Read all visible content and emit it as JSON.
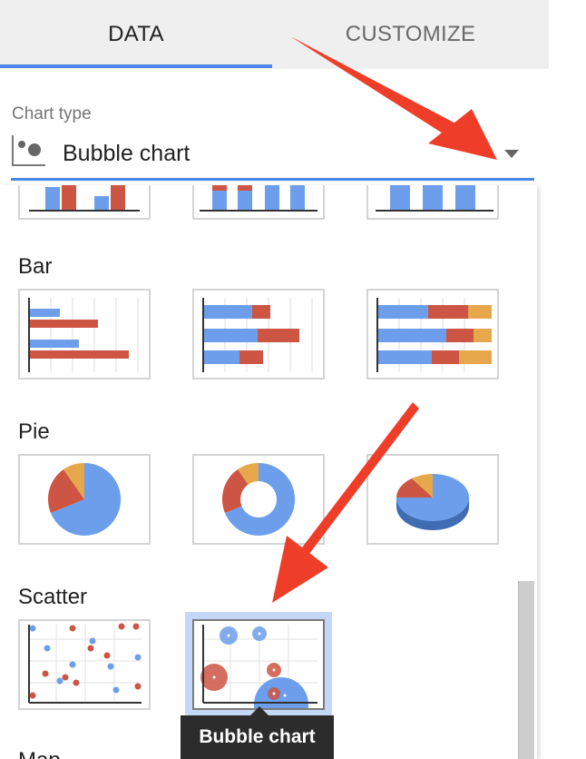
{
  "tabs": {
    "data_label": "DATA",
    "customize_label": "CUSTOMIZE"
  },
  "chart_type": {
    "label": "Chart type",
    "selected_value": "Bubble chart",
    "selected_icon": "bubble-chart-icon"
  },
  "sections": {
    "bar": "Bar",
    "pie": "Pie",
    "scatter": "Scatter",
    "map": "Map"
  },
  "tooltip": "Bubble chart",
  "colors": {
    "accent": "#4a86e8",
    "blue": "#6d9eeb",
    "red": "#cc5544",
    "orange": "#e6a84b",
    "annotation_arrow": "#ee3e2a"
  }
}
